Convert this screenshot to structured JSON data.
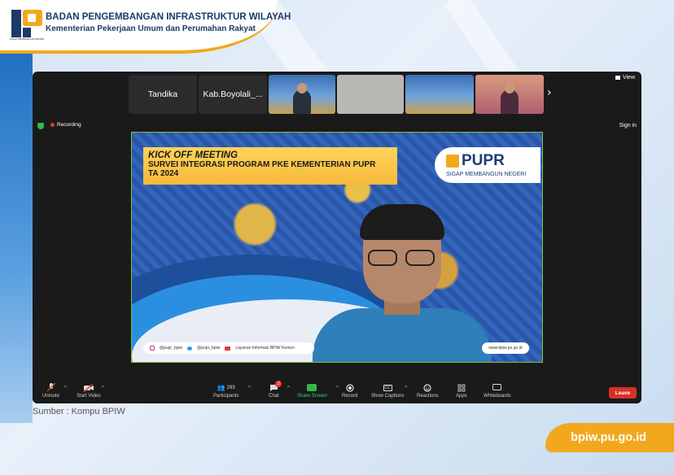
{
  "header": {
    "org_name": "BADAN PENGEMBANGAN INFRASTRUKTUR WILAYAH",
    "org_sub": "Kementerian Pekerjaan Umum dan Perumahan Rakyat",
    "logo_text": "PUPR",
    "logo_caption": "SIGAP MEMBANGUN NEGERI"
  },
  "zoom": {
    "strip": {
      "tiles": [
        {
          "name": "Tandika",
          "type": "name"
        },
        {
          "name": "Kab.Boyolali_...",
          "type": "name"
        }
      ],
      "view_label": "View"
    },
    "recording_label": "Recording",
    "sign_in_label": "Sign in",
    "slide": {
      "title_l1": "KICK OFF MEETING",
      "title_l2": "SURVEI INTEGRASI PROGRAM PKE KEMENTERIAN PUPR",
      "title_l3": "TA 2024",
      "brand": "PUPR",
      "brand_tagline": "SIGAP MEMBANGUN NEGERI",
      "social": [
        "@pupr_bpiw",
        "@pupr_bpiw",
        "Layanan Informasi BPIW Kemen"
      ],
      "site": "www.bpiw.pu.go.id"
    },
    "controls": {
      "unmute": "Unmute",
      "start_video": "Start Video",
      "participants": "Participants",
      "participants_count": "293",
      "chat": "Chat",
      "chat_badge": "2",
      "share_screen": "Share Screen",
      "record": "Record",
      "show_captions": "Show Captions",
      "reactions": "Reactions",
      "apps": "Apps",
      "whiteboards": "Whiteboards",
      "leave": "Leave",
      "cc_text": "CC"
    }
  },
  "source_caption": "Sumber : Kompu BPIW",
  "footer_site": "bpiw.pu.go.id",
  "colors": {
    "accent": "#f2a81d",
    "navy": "#1b3a6b",
    "zoom_bg": "#1a1a1a",
    "share_green": "#2fd65f",
    "leave_red": "#d93025"
  }
}
